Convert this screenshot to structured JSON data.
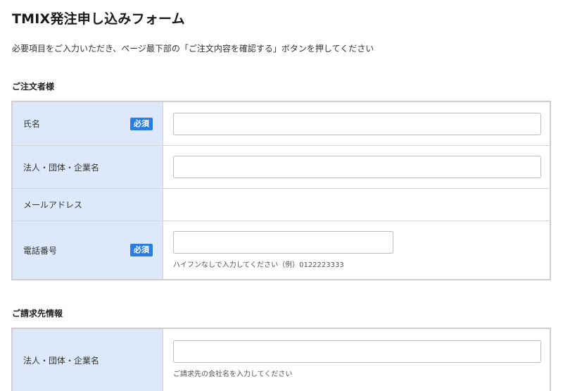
{
  "page": {
    "title": "TMIX発注申し込みフォーム",
    "intro": "必要項目をご入力いただき、ページ最下部の「ご注文内容を確認する」ボタンを押してください"
  },
  "orderer": {
    "section_title": "ご注文者様",
    "required_badge": "必須",
    "rows": [
      {
        "label": "氏名",
        "required": true,
        "value": "",
        "placeholder": ""
      },
      {
        "label": "法人・団体・企業名",
        "required": false,
        "value": "",
        "placeholder": ""
      },
      {
        "label": "メールアドレス",
        "required": false
      },
      {
        "label": "電話番号",
        "required": true,
        "value": "",
        "placeholder": "",
        "hint": "ハイフンなしで入力してください（例）0122223333"
      }
    ]
  },
  "billing": {
    "section_title": "ご請求先情報",
    "rows": [
      {
        "label": "法人・団体・企業名",
        "required": false,
        "value": "",
        "placeholder": "",
        "hint": "ご請求先の会社名を入力してください"
      }
    ]
  },
  "colors": {
    "label_background": "#dde9fb",
    "badge_background": "#2b7de0",
    "border": "#cfcfcf"
  }
}
